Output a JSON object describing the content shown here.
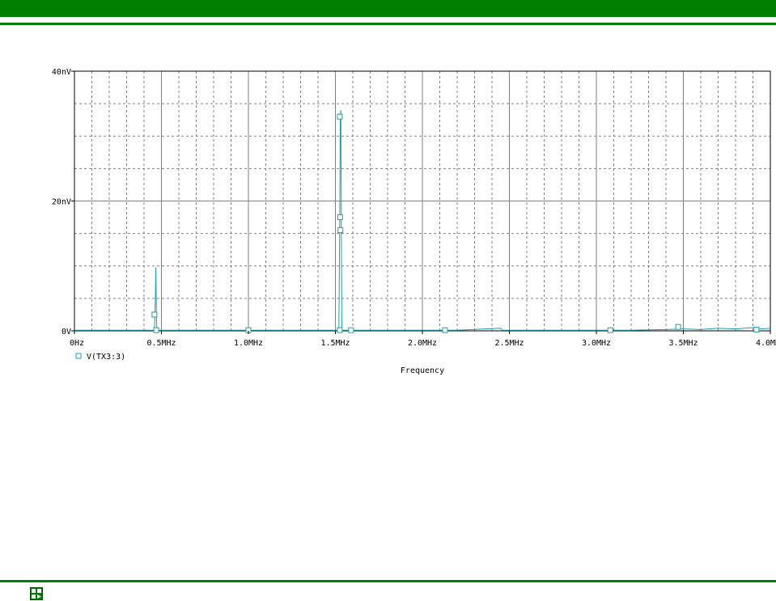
{
  "colors": {
    "band": "#008000",
    "trace": "#1aa0a8",
    "grid_major": "#808080",
    "grid_minor": "#808080",
    "axis": "#000000"
  },
  "status_bar": {
    "icon": "probe-status-icon"
  },
  "chart_data": {
    "type": "line",
    "xlabel": "Frequency",
    "ylabel": "",
    "x_unit": "MHz",
    "xlim": [
      0,
      4.0
    ],
    "ylim": [
      0,
      40
    ],
    "y_unit": "nV",
    "x_ticks": [
      0,
      0.5,
      1.0,
      1.5,
      2.0,
      2.5,
      3.0,
      3.5,
      4.0
    ],
    "x_tick_labels": [
      "0Hz",
      "0.5MHz",
      "1.0MHz",
      "1.5MHz",
      "2.0MHz",
      "2.5MHz",
      "3.0MHz",
      "3.5MHz",
      "4.0MHz"
    ],
    "y_ticks": [
      0,
      20,
      40
    ],
    "y_tick_labels": [
      "0V",
      "20nV",
      "40nV"
    ],
    "grid": true,
    "legend_position": "bottom-left",
    "series": [
      {
        "name": "V(TX3:3)",
        "color": "#1aa0a8",
        "marker": "square",
        "points": [
          [
            0.0,
            0.1
          ],
          [
            0.1,
            0.1
          ],
          [
            0.2,
            0.1
          ],
          [
            0.3,
            0.1
          ],
          [
            0.4,
            0.1
          ],
          [
            0.46,
            0.1
          ],
          [
            0.465,
            5.0
          ],
          [
            0.468,
            9.8
          ],
          [
            0.471,
            2.5
          ],
          [
            0.474,
            0.1
          ],
          [
            0.6,
            0.1
          ],
          [
            0.8,
            0.1
          ],
          [
            1.0,
            0.1
          ],
          [
            1.2,
            0.1
          ],
          [
            1.4,
            0.1
          ],
          [
            1.52,
            0.1
          ],
          [
            1.525,
            17.5
          ],
          [
            1.528,
            33.0
          ],
          [
            1.531,
            34.0
          ],
          [
            1.534,
            15.5
          ],
          [
            1.537,
            0.1
          ],
          [
            1.6,
            0.1
          ],
          [
            1.8,
            0.1
          ],
          [
            2.0,
            0.1
          ],
          [
            2.2,
            0.1
          ],
          [
            2.45,
            0.4
          ],
          [
            2.46,
            0.1
          ],
          [
            2.6,
            0.1
          ],
          [
            2.8,
            0.1
          ],
          [
            3.0,
            0.1
          ],
          [
            3.2,
            0.1
          ],
          [
            3.4,
            0.2
          ],
          [
            3.5,
            0.3
          ],
          [
            3.6,
            0.2
          ],
          [
            3.7,
            0.4
          ],
          [
            3.8,
            0.3
          ],
          [
            3.9,
            0.5
          ],
          [
            3.95,
            0.3
          ],
          [
            4.0,
            0.4
          ]
        ],
        "marker_points": [
          [
            0.46,
            2.5
          ],
          [
            0.47,
            0.1
          ],
          [
            1.0,
            0.1
          ],
          [
            1.525,
            33.0
          ],
          [
            1.527,
            17.5
          ],
          [
            1.529,
            15.5
          ],
          [
            1.525,
            0.1
          ],
          [
            1.59,
            0.1
          ],
          [
            2.13,
            0.1
          ],
          [
            3.08,
            0.1
          ],
          [
            3.47,
            0.6
          ],
          [
            3.92,
            0.2
          ]
        ]
      }
    ]
  }
}
